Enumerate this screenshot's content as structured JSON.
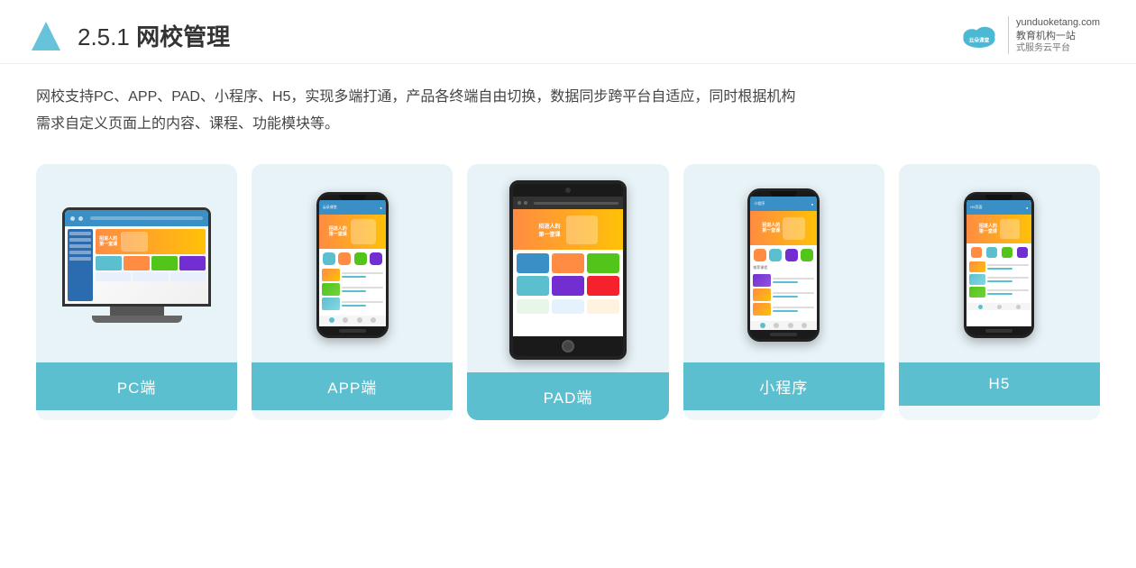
{
  "header": {
    "section_number": "2.5.1",
    "title_plain": "网校管理",
    "brand": {
      "url": "yunduoketang.com",
      "tagline1": "教育机构一站",
      "tagline2": "式服务云平台"
    }
  },
  "description": {
    "line1": "网校支持PC、APP、PAD、小程序、H5，实现多端打通，产品各终端自由切换，数据同步跨平台自适应，同时根据机构",
    "line2": "需求自定义页面上的内容、课程、功能模块等。"
  },
  "cards": [
    {
      "id": "pc",
      "label": "PC端"
    },
    {
      "id": "app",
      "label": "APP端"
    },
    {
      "id": "pad",
      "label": "PAD端"
    },
    {
      "id": "miniprogram",
      "label": "小程序"
    },
    {
      "id": "h5",
      "label": "H5"
    }
  ]
}
